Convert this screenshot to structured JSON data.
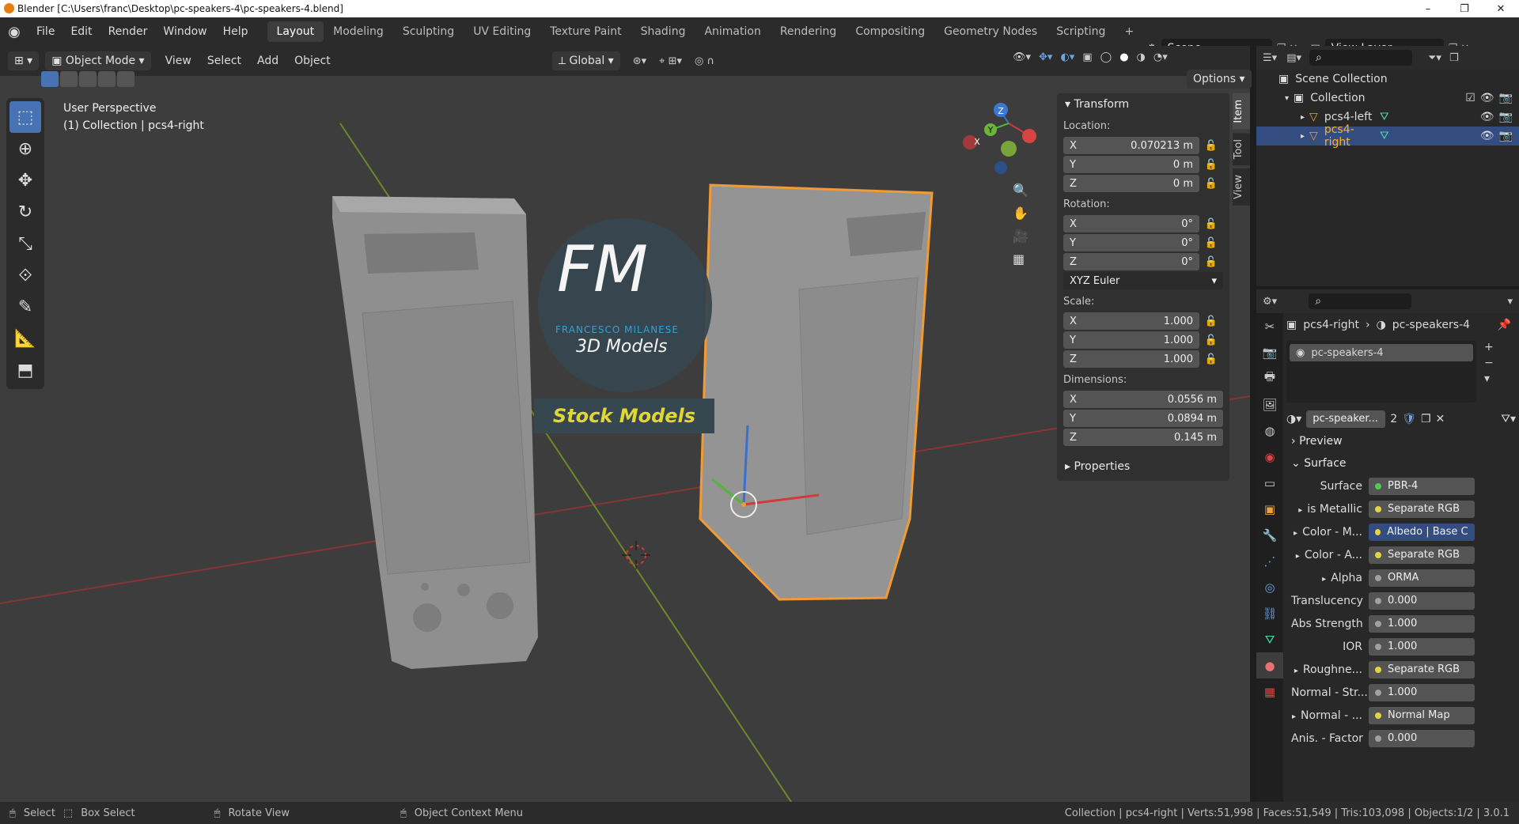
{
  "window": {
    "title": "Blender [C:\\Users\\franc\\Desktop\\pc-speakers-4\\pc-speakers-4.blend]",
    "min": "–",
    "max": "❐",
    "close": "✕"
  },
  "menu": [
    "File",
    "Edit",
    "Render",
    "Window",
    "Help"
  ],
  "workspaces": [
    "Layout",
    "Modeling",
    "Sculpting",
    "UV Editing",
    "Texture Paint",
    "Shading",
    "Animation",
    "Rendering",
    "Compositing",
    "Geometry Nodes",
    "Scripting",
    "+"
  ],
  "scene": "Scene",
  "view_layer": "View Layer",
  "viewport": {
    "mode": "Object Mode",
    "menu": [
      "View",
      "Select",
      "Add",
      "Object"
    ],
    "orientation": "Global",
    "options": "Options",
    "perspective": "User Perspective",
    "collection_info": "(1) Collection | pcs4-right"
  },
  "watermark": {
    "logo": "FM",
    "brand": "FRANCESCO MILANESE",
    "sub": "3D Models",
    "stock": "Stock Models"
  },
  "gizmo": {
    "x": "X",
    "y": "Y",
    "z": "Z"
  },
  "npanel": {
    "tabs": [
      "Item",
      "Tool",
      "View"
    ],
    "transform": "Transform",
    "location_label": "Location:",
    "location": {
      "x": "0.070213 m",
      "y": "0 m",
      "z": "0 m"
    },
    "rotation_label": "Rotation:",
    "rotation": {
      "x": "0°",
      "y": "0°",
      "z": "0°"
    },
    "euler": "XYZ Euler",
    "scale_label": "Scale:",
    "scale": {
      "x": "1.000",
      "y": "1.000",
      "z": "1.000"
    },
    "dimensions_label": "Dimensions:",
    "dimensions": {
      "x": "0.0556 m",
      "y": "0.0894 m",
      "z": "0.145 m"
    },
    "properties": "Properties",
    "axis": {
      "x": "X",
      "y": "Y",
      "z": "Z"
    }
  },
  "outliner": {
    "scene_collection": "Scene Collection",
    "collection": "Collection",
    "items": [
      "pcs4-left",
      "pcs4-right"
    ]
  },
  "properties": {
    "breadcrumb_obj": "pcs4-right",
    "breadcrumb_mat": "pc-speakers-4",
    "slot": "pc-speakers-4",
    "material_name": "pc-speaker...",
    "users": "2",
    "preview": "Preview",
    "surface_hdr": "Surface",
    "rows": [
      {
        "label": "Surface",
        "value": "PBR-4",
        "dot": "#53c653",
        "arrow": ""
      },
      {
        "label": "is Metallic",
        "value": "Separate RGB",
        "dot": "#e3d444",
        "arrow": "▸"
      },
      {
        "label": "Color - M...",
        "value": "Albedo | Base C...",
        "dot": "#e3d444",
        "arrow": "▸",
        "hl": true
      },
      {
        "label": "Color - A...",
        "value": "Separate RGB",
        "dot": "#e3d444",
        "arrow": "▸"
      },
      {
        "label": "Alpha",
        "value": "ORMA",
        "dot": "#a1a1a1",
        "arrow": "▸"
      },
      {
        "label": "Translucency",
        "value": "0.000",
        "dot": "#a1a1a1",
        "arrow": ""
      },
      {
        "label": "Abs Strength",
        "value": "1.000",
        "dot": "#a1a1a1",
        "arrow": ""
      },
      {
        "label": "IOR",
        "value": "1.000",
        "dot": "#a1a1a1",
        "arrow": ""
      },
      {
        "label": "Roughne...",
        "value": "Separate RGB",
        "dot": "#e3d444",
        "arrow": "▸"
      },
      {
        "label": "Normal - Str...",
        "value": "1.000",
        "dot": "#a1a1a1",
        "arrow": ""
      },
      {
        "label": "Normal - ...",
        "value": "Normal Map",
        "dot": "#e3d444",
        "arrow": "▸"
      },
      {
        "label": "Anis. - Factor",
        "value": "0.000",
        "dot": "#a1a1a1",
        "arrow": ""
      }
    ]
  },
  "status": {
    "select": "Select",
    "box_select": "Box Select",
    "rotate": "Rotate View",
    "context": "Object Context Menu",
    "stats": "Collection | pcs4-right | Verts:51,998 | Faces:51,549 | Tris:103,098 | Objects:1/2 | 3.0.1"
  }
}
